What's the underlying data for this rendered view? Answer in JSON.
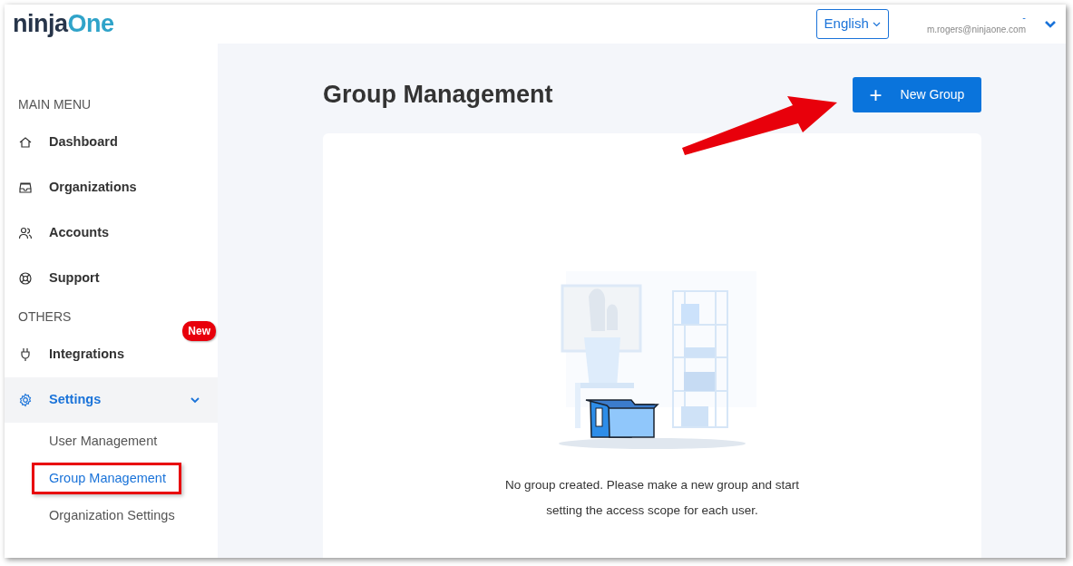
{
  "header": {
    "logo": {
      "part1": "ninja",
      "part2": "One"
    },
    "language": "English",
    "user_name": "-",
    "user_email": "m.rogers@ninjaone.com"
  },
  "sidebar": {
    "sections": [
      {
        "title": "MAIN MENU",
        "items": [
          {
            "label": "Dashboard",
            "selected": false
          },
          {
            "label": "Organizations",
            "selected": false
          },
          {
            "label": "Accounts",
            "selected": false
          },
          {
            "label": "Support",
            "selected": false
          }
        ]
      },
      {
        "title": "OTHERS",
        "items": [
          {
            "label": "Integrations",
            "selected": false,
            "badge": "New"
          },
          {
            "label": "Settings",
            "selected": true,
            "expanded": true,
            "children": [
              {
                "label": "User Management",
                "selected": false,
                "highlighted": false
              },
              {
                "label": "Group Management",
                "selected": true,
                "highlighted": true
              },
              {
                "label": "Organization Settings",
                "selected": false,
                "highlighted": false
              }
            ]
          }
        ]
      }
    ]
  },
  "main": {
    "title": "Group Management",
    "new_button": {
      "icon": "+",
      "label": "New Group"
    },
    "annotation_arrow": true,
    "empty_state": {
      "lines": [
        "No group created. Please make a new group and start",
        "setting the access scope for each user."
      ]
    }
  }
}
